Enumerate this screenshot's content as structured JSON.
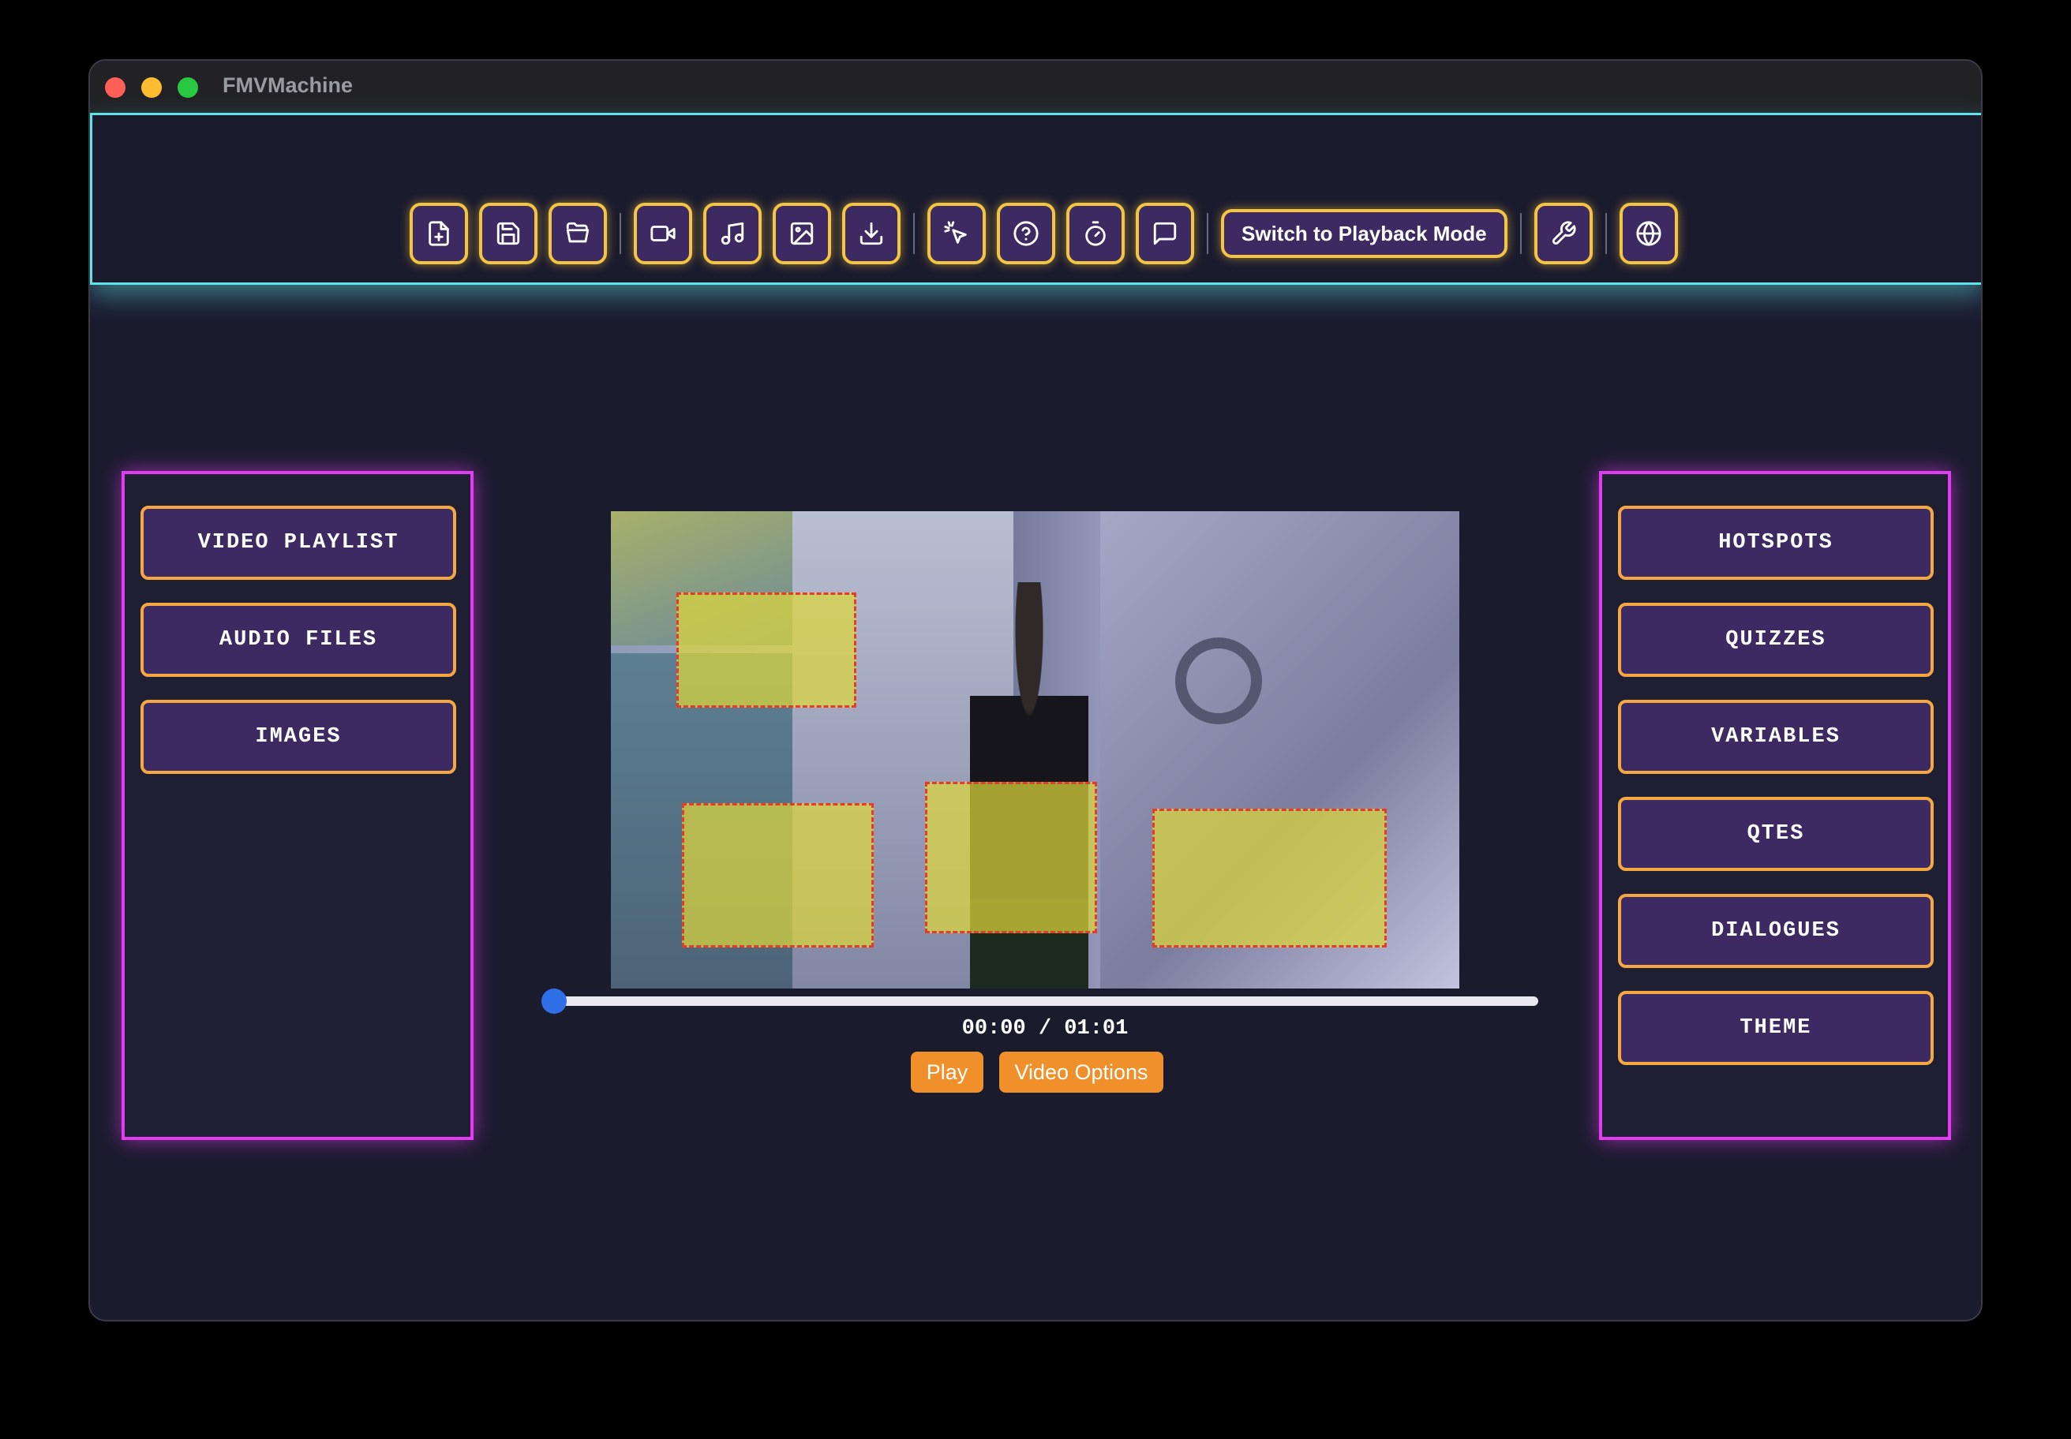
{
  "window": {
    "title": "FMVMachine"
  },
  "toolbar": {
    "groups": [
      [
        "new-project-icon",
        "save-icon",
        "open-folder-icon"
      ],
      [
        "video-camera-icon",
        "music-note-icon",
        "image-icon",
        "download-icon"
      ],
      [
        "cursor-click-icon",
        "help-circle-icon",
        "timer-icon",
        "speech-bubble-icon"
      ]
    ],
    "mode_button_label": "Switch to Playback Mode",
    "trailing_icons": [
      "wrench-icon",
      "globe-icon"
    ]
  },
  "left_panel": {
    "items": [
      "VIDEO PLAYLIST",
      "AUDIO FILES",
      "IMAGES"
    ]
  },
  "right_panel": {
    "items": [
      "HOTSPOTS",
      "QUIZZES",
      "VARIABLES",
      "QTES",
      "DIALOGUES",
      "THEME"
    ]
  },
  "video": {
    "hotspot_count": 4,
    "progress": 0.0,
    "timecode": "00:00 / 01:01"
  },
  "controls": {
    "play_label": "Play",
    "options_label": "Video Options"
  },
  "colors": {
    "toolbar_border": "#5fe3e8",
    "panel_border": "#e23cf0",
    "button_border": "#f5c542",
    "button_fill": "#3d2a63",
    "hotspot_fill": "#dcd73c",
    "hotspot_border": "#e53a2e",
    "action_button": "#f0902a",
    "seek_thumb": "#2f6fe8"
  }
}
